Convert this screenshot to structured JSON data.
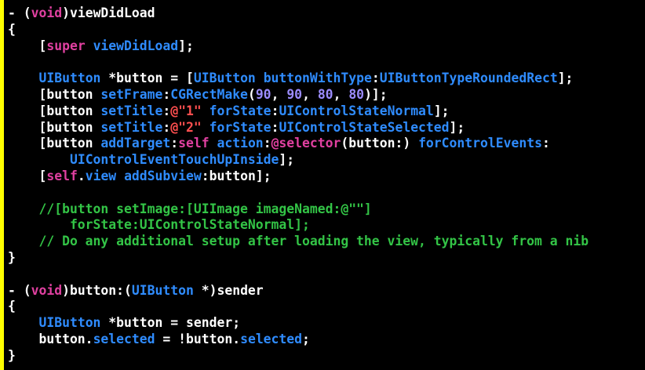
{
  "editor": {
    "colors": {
      "background": "#000000",
      "gutter_bar": "#ffff00",
      "text": "#ffffff",
      "keyword": "#e040a0",
      "type": "#2f8cff",
      "string": "#ff4f4f",
      "number": "#9c8cff",
      "comment": "#33c446"
    },
    "lines": [
      [
        [
          "text",
          "- ("
        ],
        [
          "keyword",
          "void"
        ],
        [
          "text",
          ")viewDidLoad"
        ]
      ],
      [
        [
          "text",
          "{"
        ]
      ],
      [
        [
          "text",
          "    ["
        ],
        [
          "keyword",
          "super"
        ],
        [
          "text",
          " "
        ],
        [
          "type",
          "viewDidLoad"
        ],
        [
          "text",
          "];"
        ]
      ],
      [],
      [
        [
          "text",
          "    "
        ],
        [
          "type",
          "UIButton"
        ],
        [
          "text",
          " *button = ["
        ],
        [
          "type",
          "UIButton"
        ],
        [
          "text",
          " "
        ],
        [
          "type",
          "buttonWithType"
        ],
        [
          "text",
          ":"
        ],
        [
          "type",
          "UIButtonTypeRoundedRect"
        ],
        [
          "text",
          "];"
        ]
      ],
      [
        [
          "text",
          "    [button "
        ],
        [
          "type",
          "setFrame"
        ],
        [
          "text",
          ":"
        ],
        [
          "type",
          "CGRectMake"
        ],
        [
          "text",
          "("
        ],
        [
          "number",
          "90"
        ],
        [
          "text",
          ", "
        ],
        [
          "number",
          "90"
        ],
        [
          "text",
          ", "
        ],
        [
          "number",
          "80"
        ],
        [
          "text",
          ", "
        ],
        [
          "number",
          "80"
        ],
        [
          "text",
          ")];"
        ]
      ],
      [
        [
          "text",
          "    [button "
        ],
        [
          "type",
          "setTitle"
        ],
        [
          "text",
          ":"
        ],
        [
          "string",
          "@\"1\""
        ],
        [
          "text",
          " "
        ],
        [
          "type",
          "forState"
        ],
        [
          "text",
          ":"
        ],
        [
          "type",
          "UIControlStateNormal"
        ],
        [
          "text",
          "];"
        ]
      ],
      [
        [
          "text",
          "    [button "
        ],
        [
          "type",
          "setTitle"
        ],
        [
          "text",
          ":"
        ],
        [
          "string",
          "@\"2\""
        ],
        [
          "text",
          " "
        ],
        [
          "type",
          "forState"
        ],
        [
          "text",
          ":"
        ],
        [
          "type",
          "UIControlStateSelected"
        ],
        [
          "text",
          "];"
        ]
      ],
      [
        [
          "text",
          "    [button "
        ],
        [
          "type",
          "addTarget"
        ],
        [
          "text",
          ":"
        ],
        [
          "keyword",
          "self"
        ],
        [
          "text",
          " "
        ],
        [
          "type",
          "action"
        ],
        [
          "text",
          ":"
        ],
        [
          "keyword",
          "@selector"
        ],
        [
          "text",
          "(button:) "
        ],
        [
          "type",
          "forControlEvents"
        ],
        [
          "text",
          ":"
        ]
      ],
      [
        [
          "text",
          "        "
        ],
        [
          "type",
          "UIControlEventTouchUpInside"
        ],
        [
          "text",
          "];"
        ]
      ],
      [
        [
          "text",
          "    ["
        ],
        [
          "keyword",
          "self"
        ],
        [
          "text",
          "."
        ],
        [
          "type",
          "view"
        ],
        [
          "text",
          " "
        ],
        [
          "type",
          "addSubview"
        ],
        [
          "text",
          ":button];"
        ]
      ],
      [],
      [
        [
          "comment",
          "    //[button setImage:[UIImage imageNamed:@\"\"]"
        ]
      ],
      [
        [
          "comment",
          "        forState:UIControlStateNormal];"
        ]
      ],
      [
        [
          "comment",
          "    // Do any additional setup after loading the view, typically from a nib"
        ]
      ],
      [
        [
          "text",
          "}"
        ]
      ],
      [],
      [
        [
          "text",
          "- ("
        ],
        [
          "keyword",
          "void"
        ],
        [
          "text",
          ")button:("
        ],
        [
          "type",
          "UIButton"
        ],
        [
          "text",
          " *)sender"
        ]
      ],
      [
        [
          "text",
          "{"
        ]
      ],
      [
        [
          "text",
          "    "
        ],
        [
          "type",
          "UIButton"
        ],
        [
          "text",
          " *button = sender;"
        ]
      ],
      [
        [
          "text",
          "    button."
        ],
        [
          "type",
          "selected"
        ],
        [
          "text",
          " = !button."
        ],
        [
          "type",
          "selected"
        ],
        [
          "text",
          ";"
        ]
      ],
      [
        [
          "text",
          "}"
        ]
      ]
    ]
  }
}
